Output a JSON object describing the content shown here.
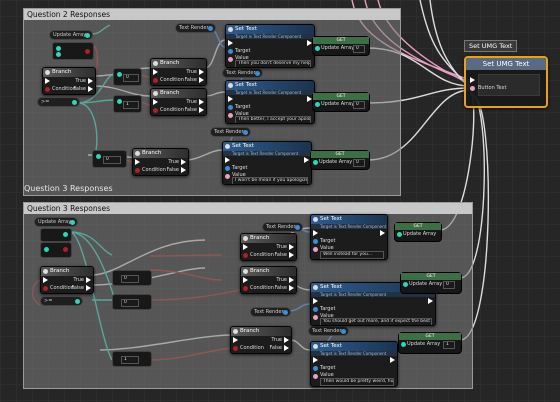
{
  "comments": {
    "q2_header": "Question 2 Responses",
    "q3_header": "Question 3 Responses",
    "q3_bubble": "Question 3 Responses"
  },
  "nodes": {
    "update_array": "Update Array",
    "branch": "Branch",
    "set_text": "Set Text",
    "set_text_sub": "Target is Text Render Component",
    "target": "Target",
    "value": "Value",
    "condition": "Condition",
    "true_label": "True",
    "false_label": "False",
    "get": "GET",
    "text_render": "Text Render",
    "eq": "==",
    "ge": ">="
  },
  "q2": {
    "value1": "Then you don't deserve my help!",
    "value2": "Then better, I accept your apology.",
    "value3": "I won't be mean if you apologize."
  },
  "q3": {
    "value1": "Well instead for you...",
    "value2": "You should get out more, and if expect the best of them.",
    "value3": "Then would be pretty weird, huh?"
  },
  "pins": {
    "update_array_index": "Update Array",
    "index0": "0",
    "index1": "1"
  },
  "set_umg": {
    "tab_label": "Set UMG Text",
    "tooltip": "Set UMG Text",
    "title": "Set UMG Text",
    "pin_label": "Button Text"
  }
}
